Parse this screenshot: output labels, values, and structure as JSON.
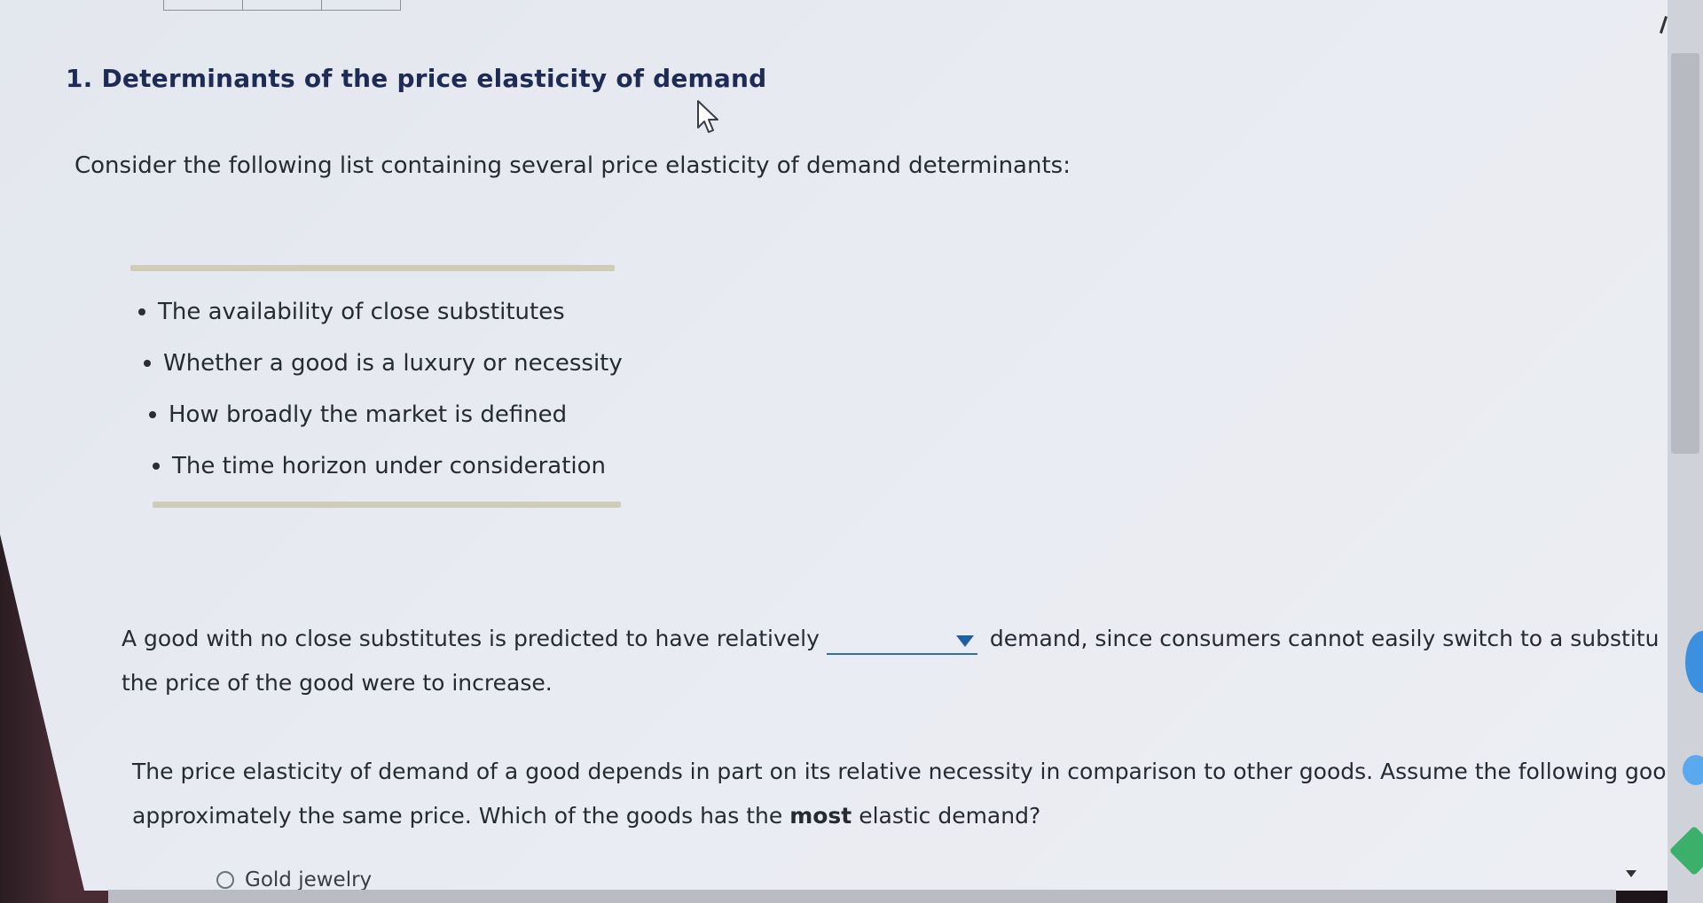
{
  "heading": "1. Determinants of the price elasticity of demand",
  "intro": "Consider the following list containing several price elasticity of demand determinants:",
  "determinants": [
    "The availability of close substitutes",
    "Whether a good is a luxury or necessity",
    "How broadly the market is defined",
    "The time horizon under consideration"
  ],
  "question1": {
    "before_blank": "A good with no close substitutes is predicted to have relatively",
    "after_blank": "demand, since consumers cannot easily switch to a substitu",
    "line2": "the price of the good were to increase.",
    "dropdown_value": ""
  },
  "question2": {
    "line1": "The price elasticity of demand of a good depends in part on its relative necessity in comparison to other goods. Assume the following goo",
    "line2_part1": "approximately the same price. Which of the goods has the",
    "line2_bold": "most",
    "line2_part2": "elastic demand?"
  },
  "options": [
    "Gold jewelry"
  ],
  "icons": {
    "cursor": "mouse-pointer-icon",
    "dropdown": "chevron-down-icon"
  },
  "colors": {
    "heading": "#1e2b55",
    "accent": "#1f5fa3",
    "rule": "#cfcdb6"
  }
}
